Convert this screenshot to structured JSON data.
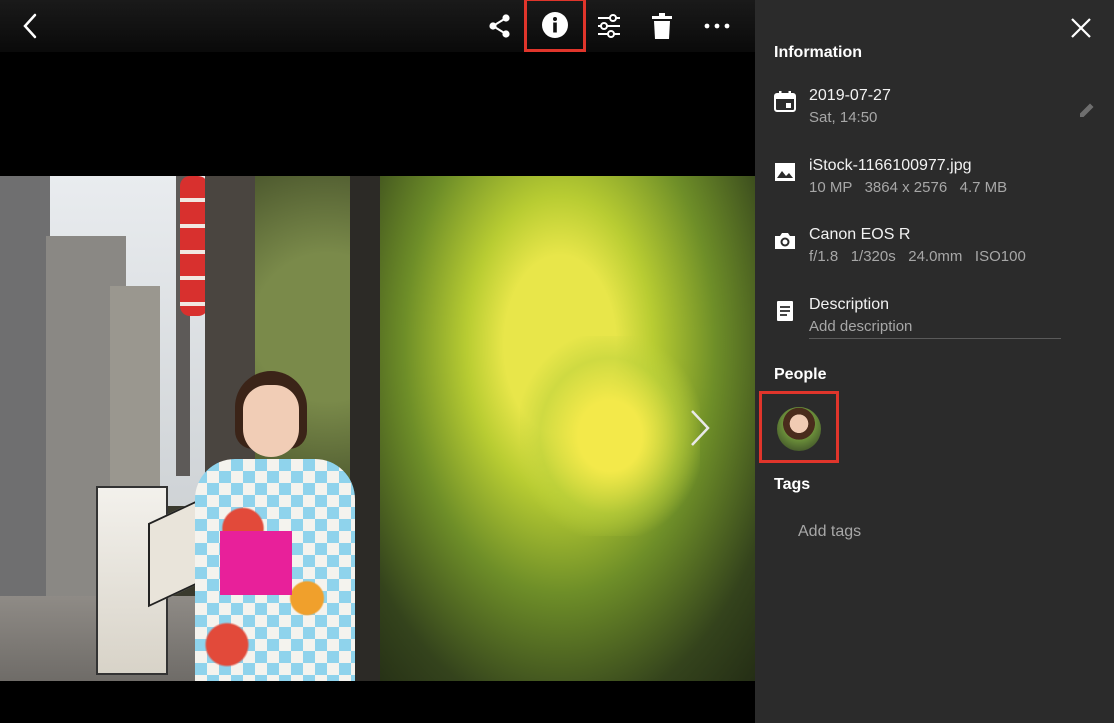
{
  "toolbar": {
    "back": "back-icon",
    "share": "share-icon",
    "info": "info-icon",
    "adjust": "adjust-icon",
    "delete": "delete-icon",
    "more": "more-icon",
    "highlight_color": "#e0352b"
  },
  "panel": {
    "title": "Information",
    "date": "2019-07-27",
    "day_time": "Sat, 14:50",
    "file_name": "iStock-1166100977.jpg",
    "file_meta": "10 MP   3864 x 2576   4.7 MB",
    "camera": "Canon EOS R",
    "camera_meta": "f/1.8   1/320s   24.0mm   ISO100",
    "description_label": "Description",
    "description_placeholder": "Add description",
    "people_title": "People",
    "tags_title": "Tags",
    "add_tags": "Add tags"
  },
  "colors": {
    "panel_bg": "#2b2b2b",
    "viewer_bg": "#000000",
    "secondary_text": "#a7a7a7"
  }
}
